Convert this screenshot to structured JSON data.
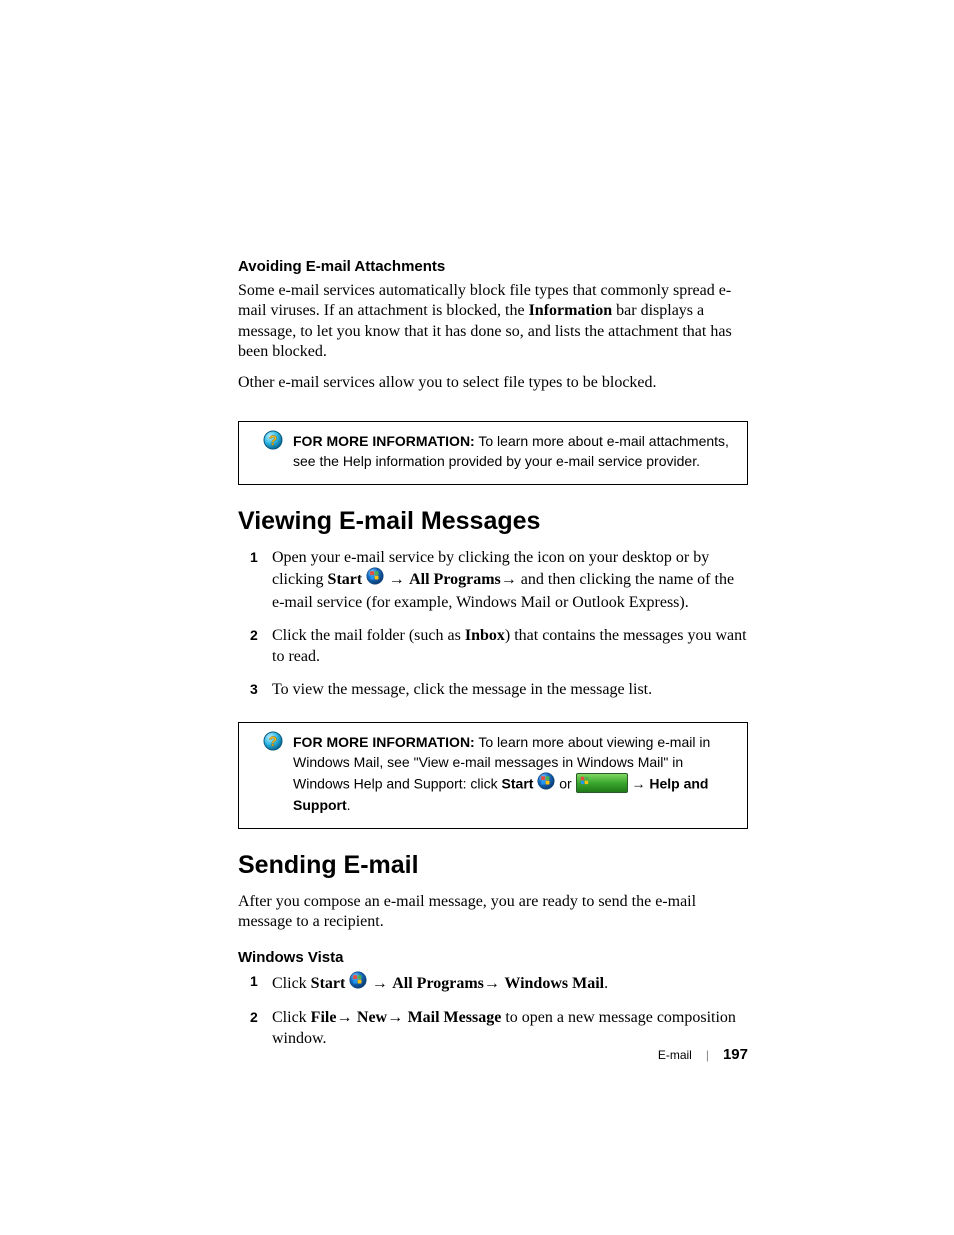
{
  "section1": {
    "heading": "Avoiding E-mail Attachments",
    "para1_a": "Some e-mail services automatically block file types that commonly spread e-mail viruses. If an attachment is blocked, the ",
    "para1_bold": "Information",
    "para1_b": " bar displays a message, to let you know that it has done so, and lists the attachment that has been blocked.",
    "para2": "Other e-mail services allow you to select file types to be blocked."
  },
  "infobox1": {
    "lead": "FOR MORE INFORMATION:",
    "text": " To learn more about e-mail attachments, see the Help information provided by your e-mail service provider."
  },
  "section2": {
    "heading": "Viewing E-mail Messages",
    "steps": [
      {
        "num": "1",
        "a": "Open your e-mail service by clicking the icon on your desktop or by clicking ",
        "b_bold": "Start",
        "c": " ",
        "d_arrow": " → ",
        "e_bold": "All Programs",
        "f_arrow": "→",
        "g": " and then clicking the name of the e-mail service (for example, Windows Mail or Outlook Express)."
      },
      {
        "num": "2",
        "a": "Click the mail folder (such as ",
        "b_bold": "Inbox",
        "c": ") that contains the messages you want to read."
      },
      {
        "num": "3",
        "a": "To view the message, click the message in the message list."
      }
    ]
  },
  "infobox2": {
    "lead": "FOR MORE INFORMATION:",
    "a": " To learn more about viewing e-mail in Windows Mail, see \"View e-mail messages in Windows Mail\" in Windows Help and Support: click ",
    "b_bold": "Start",
    "c": " ",
    "d": " or ",
    "e_arrow": " → ",
    "f_bold": "Help and Support",
    "g": "."
  },
  "section3": {
    "heading": "Sending E-mail",
    "para": "After you compose an e-mail message, you are ready to send the e-mail message to a recipient.",
    "subhead": "Windows Vista",
    "steps": [
      {
        "num": "1",
        "a": "Click ",
        "b_bold": "Start",
        "c": " ",
        "d_arrow": " → ",
        "e_bold": "All Programs",
        "f_arrow": "→ ",
        "g_bold": "Windows Mail",
        "h": "."
      },
      {
        "num": "2",
        "a": "Click ",
        "b_bold": "File",
        "c_arrow": "→ ",
        "d_bold": "New",
        "e_arrow": "→ ",
        "f_bold": "Mail Message",
        "g": " to open a new message composition window."
      }
    ]
  },
  "footer": {
    "label": "E-mail",
    "page": "197"
  }
}
